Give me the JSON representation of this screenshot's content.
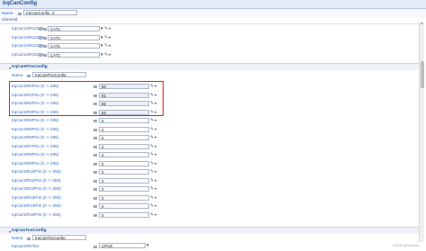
{
  "window": {
    "title": "IrqCanConfig"
  },
  "name_row": {
    "label": "Name",
    "value": "IrqCanConfig_0"
  },
  "group_label": "General",
  "top_rows": [
    {
      "label": "IrqCan1SR12Cat",
      "value": "CAT1"
    },
    {
      "label": "IrqCan1SR13Cat",
      "value": "CAT1"
    },
    {
      "label": "IrqCan1SR14Cat",
      "value": "CAT1"
    },
    {
      "label": "IrqCan1SR15Cat",
      "value": "CAT1"
    }
  ],
  "prio_section": {
    "title": "IrqCanPrioConfig",
    "name_label": "Name",
    "name_value": "IrqCanPrioConfig",
    "rows": [
      {
        "label": "IrqCanSR0Prio (0 -> 255)",
        "value": "80"
      },
      {
        "label": "IrqCanSR1Prio (0 -> 255)",
        "value": "81"
      },
      {
        "label": "IrqCanSR2Prio (0 -> 255)",
        "value": "82"
      },
      {
        "label": "IrqCanSR3Prio (0 -> 255)",
        "value": "83"
      },
      {
        "label": "IrqCanSR4Prio (0 -> 255)",
        "value": "0"
      },
      {
        "label": "IrqCanSR5Prio (0 -> 255)",
        "value": "0"
      },
      {
        "label": "IrqCanSR6Prio (0 -> 255)",
        "value": "0"
      },
      {
        "label": "IrqCanSR7Prio (0 -> 255)",
        "value": "0"
      },
      {
        "label": "IrqCanSR8Prio (0 -> 255)",
        "value": "0"
      },
      {
        "label": "IrqCanSR9Prio (0 -> 255)",
        "value": "0"
      },
      {
        "label": "IrqCanSR10Prio (0 -> 255)",
        "value": "0"
      },
      {
        "label": "IrqCanSR11Prio (0 -> 255)",
        "value": "0"
      },
      {
        "label": "IrqCanSR12Prio (0 -> 255)",
        "value": "0"
      },
      {
        "label": "IrqCanSR13Prio (0 -> 255)",
        "value": "0"
      },
      {
        "label": "IrqCanSR14Prio (0 -> 255)",
        "value": "0"
      },
      {
        "label": "IrqCanSR15Prio (0 -> 255)",
        "value": "0"
      }
    ]
  },
  "tos_section": {
    "title": "IrqCanTosConfig",
    "name_label": "Name",
    "name_value": "IrqCanTosConfig",
    "first_row": {
      "label": "IrqCanSR0Tos",
      "value": "CPU0"
    }
  },
  "watermark": "CSDN @Vehicle"
}
